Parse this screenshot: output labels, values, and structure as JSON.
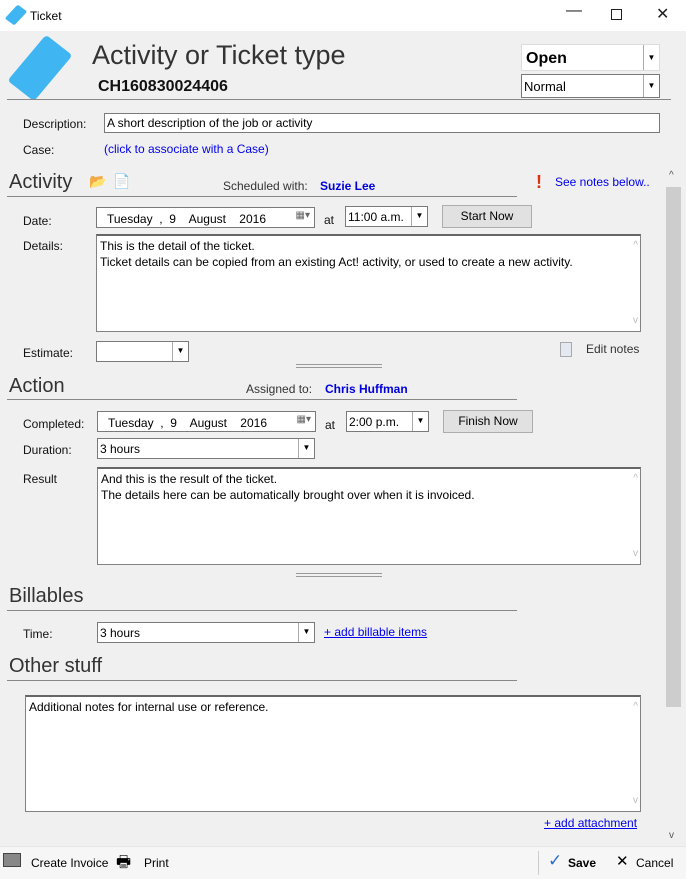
{
  "window": {
    "title": "Ticket"
  },
  "header": {
    "type": "Activity or Ticket type",
    "id": "CH160830024406",
    "status": "Open",
    "priority": "Normal"
  },
  "description": {
    "label": "Description:",
    "value": "A short description of the job or activity"
  },
  "case": {
    "label": "Case:",
    "link": "(click to associate with a Case)"
  },
  "activity": {
    "title": "Activity",
    "scheduled_label": "Scheduled with:",
    "scheduled_with": "Suzie Lee",
    "notes_link": "See notes below..",
    "date_label": "Date:",
    "date": "Tuesday  ,  9    August    2016",
    "at": "at",
    "time": "11:00 a.m.",
    "start_now": "Start Now",
    "details_label": "Details:",
    "details_line1": "This is the detail of the ticket.",
    "details_line2": "Ticket details can be copied from an existing Act! activity, or used to create a new activity.",
    "estimate_label": "Estimate:",
    "estimate": "",
    "edit_notes": "Edit notes"
  },
  "action": {
    "title": "Action",
    "assigned_label": "Assigned to:",
    "assigned_to": "Chris Huffman",
    "completed_label": "Completed:",
    "date": "Tuesday  ,  9    August    2016",
    "at": "at",
    "time": "2:00 p.m.",
    "finish_now": "Finish Now",
    "duration_label": "Duration:",
    "duration": "3 hours",
    "result_label": "Result",
    "result_line1": "And this is the result of the ticket.",
    "result_line2": "The details here can be automatically brought over when it is invoiced."
  },
  "billables": {
    "title": "Billables",
    "time_label": "Time:",
    "time": "3 hours",
    "add_link": "+ add billable items"
  },
  "other": {
    "title": "Other stuff",
    "notes": "Additional notes for internal use or reference.",
    "add_attachment": "+ add attachment"
  },
  "footer": {
    "create_invoice": "Create Invoice",
    "print": "Print",
    "save": "Save",
    "cancel": "Cancel"
  },
  "colors": {
    "accent": "#3fb6f2",
    "link": "#0000ee"
  }
}
